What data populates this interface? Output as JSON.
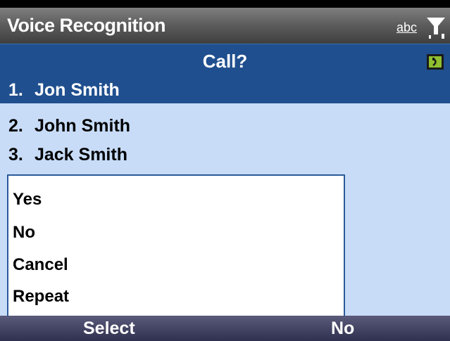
{
  "title_bar": {
    "title": "Voice Recognition",
    "input_mode": "abc",
    "signal_icon": "signal-strength-icon"
  },
  "header": {
    "prompt": "Call?",
    "speaker_icon": "speaker-icon"
  },
  "candidates": [
    {
      "number": "1.",
      "name": "Jon Smith",
      "selected": true
    },
    {
      "number": "2.",
      "name": "John Smith",
      "selected": false
    },
    {
      "number": "3.",
      "name": "Jack Smith",
      "selected": false
    }
  ],
  "menu": {
    "items": [
      "Yes",
      "No",
      "Cancel",
      "Repeat"
    ]
  },
  "softkeys": {
    "left": "Select",
    "right": "No"
  },
  "colors": {
    "highlight": "#1f4f8f",
    "background": "#c8dcf8"
  }
}
